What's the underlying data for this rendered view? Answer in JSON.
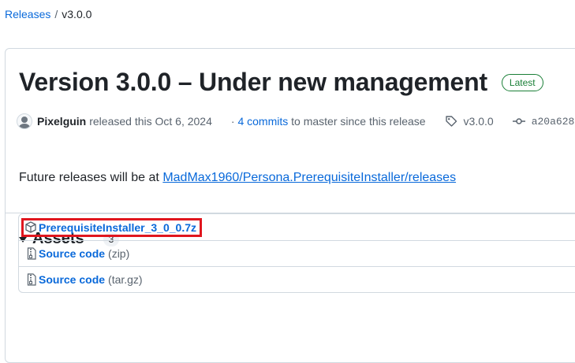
{
  "breadcrumb": {
    "releases": "Releases",
    "separator": "/",
    "current": "v3.0.0"
  },
  "release": {
    "title": "Version 3.0.0 – Under new management",
    "latest_badge": "Latest",
    "author": "Pixelguin",
    "released_text": "released this Oct 6, 2024",
    "commits_prefix": "·",
    "commits_link": "4 commits",
    "commits_suffix": "to master since this release",
    "tag": "v3.0.0",
    "commit_hash": "a20a628",
    "body_prefix": "Future releases will be at",
    "body_link": "MadMax1960/Persona.PrerequisiteInstaller/releases"
  },
  "assets": {
    "title": "Assets",
    "count": "3",
    "items": [
      {
        "name": "PrerequisiteInstaller_3_0_0.7z",
        "suffix": "",
        "icon": "package-icon",
        "highlighted": true
      },
      {
        "name": "Source code",
        "suffix": "(zip)",
        "icon": "file-zip-icon",
        "highlighted": false
      },
      {
        "name": "Source code",
        "suffix": "(tar.gz)",
        "icon": "file-zip-icon",
        "highlighted": false
      }
    ]
  },
  "colors": {
    "link": "#0969da",
    "latest": "#1a7f37",
    "highlight": "#e0161e",
    "border": "#d1d9e0"
  }
}
